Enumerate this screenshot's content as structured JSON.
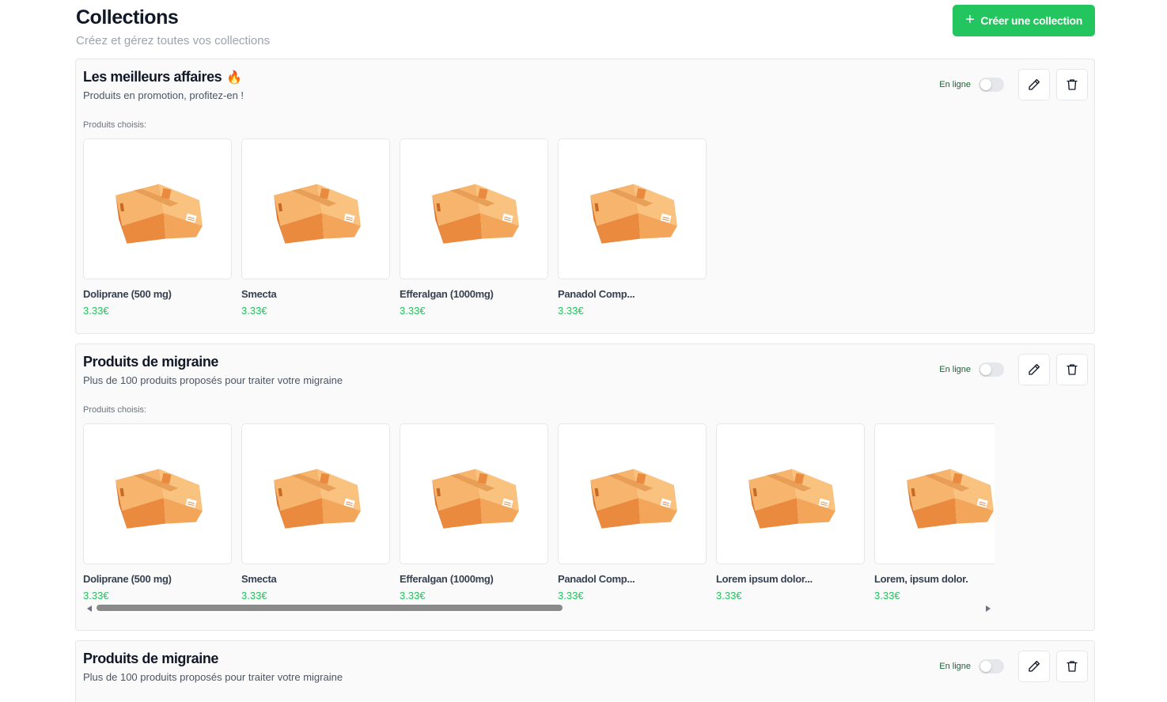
{
  "header": {
    "title": "Collections",
    "subtitle": "Créez et gérez toutes vos collections",
    "create_button": "Créer une collection"
  },
  "colors": {
    "accent_green": "#22c55e",
    "price_green": "#22c55e",
    "card_border": "#e5e7eb"
  },
  "collections": [
    {
      "title": "Les meilleurs affaires",
      "title_emoji": "🔥",
      "description": "Produits en promotion, profitez-en !",
      "chosen_label": "Produits choisis:",
      "online_label": "En ligne",
      "online": false,
      "products": [
        {
          "name": "Doliprane (500 mg)",
          "price": "3.33€"
        },
        {
          "name": "Smecta",
          "price": "3.33€"
        },
        {
          "name": "Efferalgan (1000mg)",
          "price": "3.33€"
        },
        {
          "name": "Panadol Comp...",
          "price": "3.33€"
        }
      ]
    },
    {
      "title": "Produits de migraine",
      "description": "Plus de 100 produits proposés pour traiter votre migraine",
      "chosen_label": "Produits choisis:",
      "online_label": "En ligne",
      "online": false,
      "products": [
        {
          "name": "Doliprane (500 mg)",
          "price": "3.33€"
        },
        {
          "name": "Smecta",
          "price": "3.33€"
        },
        {
          "name": "Efferalgan (1000mg)",
          "price": "3.33€"
        },
        {
          "name": "Panadol Comp...",
          "price": "3.33€"
        },
        {
          "name": "Lorem ipsum dolor...",
          "price": "3.33€"
        },
        {
          "name": "Lorem, ipsum dolor.",
          "price": "3.33€"
        }
      ]
    },
    {
      "title": "Produits de migraine",
      "description": "Plus de 100 produits proposés pour traiter votre migraine",
      "online_label": "En ligne",
      "online": false
    }
  ]
}
